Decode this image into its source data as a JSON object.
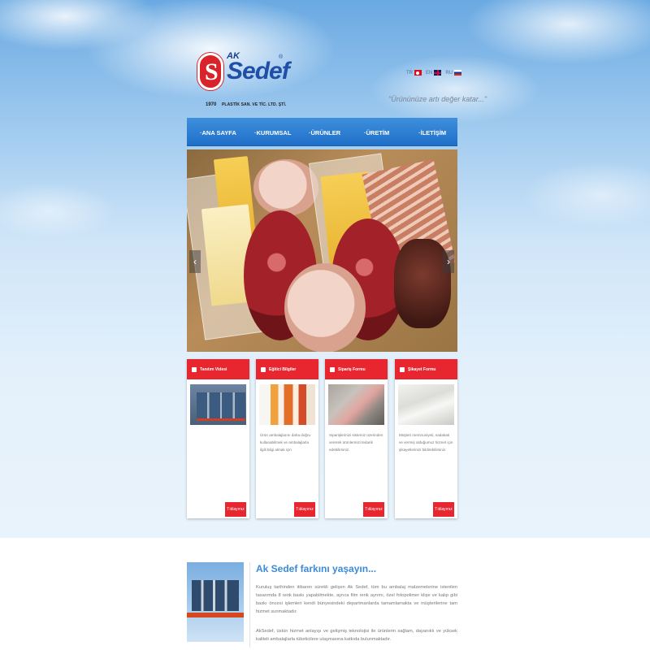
{
  "header": {
    "logo": {
      "letter": "S",
      "ak": "AK",
      "name": "Sedef",
      "reg": "®",
      "year": "1970",
      "subtitle": "PLASTİK SAN. VE TİC. LTD. ŞTİ."
    },
    "languages": [
      {
        "code": "TR",
        "flag": "flag-tr-icon"
      },
      {
        "code": "EN",
        "flag": "flag-en-icon"
      },
      {
        "code": "RU",
        "flag": "flag-ru-icon"
      }
    ],
    "slogan": "\"Ürününüze artı değer katar...\""
  },
  "nav": {
    "items": [
      {
        "label": "·ANA SAYFA"
      },
      {
        "label": "·KURUMSAL"
      },
      {
        "label": "·ÜRÜNLER"
      },
      {
        "label": "·ÜRETİM"
      },
      {
        "label": "·İLETİŞİM"
      }
    ]
  },
  "slider": {
    "prev": "‹",
    "next": "›"
  },
  "cards": [
    {
      "title": "Tanıtım Videsi",
      "text": "",
      "button": "Tıklayınız",
      "icon": "video-icon"
    },
    {
      "title": "Eğitici Bilgiler",
      "text": "Ürün ambalajlarını daha doğru kullanabilmek ve ambalajlarla ilgili bilgi almak için",
      "button": "Tıklayınız",
      "icon": "book-icon"
    },
    {
      "title": "Sipariş Formu",
      "text": "Siparişlerinizi sistemiz üzerinden vererek ürünlerinizi tedarik edebilirsiniz.",
      "button": "Tıklayınız",
      "icon": "cart-icon"
    },
    {
      "title": "Şikayet Formu",
      "text": "Müşteri memnuniyeti, sadakati ve vermiş olduğumuz hizmet için şikayetlerinizi bildirebilirsiniz.",
      "button": "Tıklayınız",
      "icon": "document-icon"
    }
  ],
  "about": {
    "title": "Ak Sedef farkını yaşayın...",
    "p1": "Kuruluş tarihinden itibaren sürekli gelişen Ak Sedef, tüm bu ambalaj malzemelerine istenilen tasarımda 8 renk baskı yapabilmekte, ayrıca film renk ayrımı, özel fotopolimer klişe ve kalıp gibi baskı öncesi işlemleri kendi bünyesindeki departmanlarda tamamlamakta ve müşterilerine tam hizmet sunmaktadır.",
    "p2": "AkSedef, üstün hizmet anlayışı ve gelişmiş teknolojisi ile ürünlerin sağlam, dayanıklı ve yüksek kaliteli ambalajlarla tüketicilere ulaşmasına katkıda bulunmaktadır."
  }
}
